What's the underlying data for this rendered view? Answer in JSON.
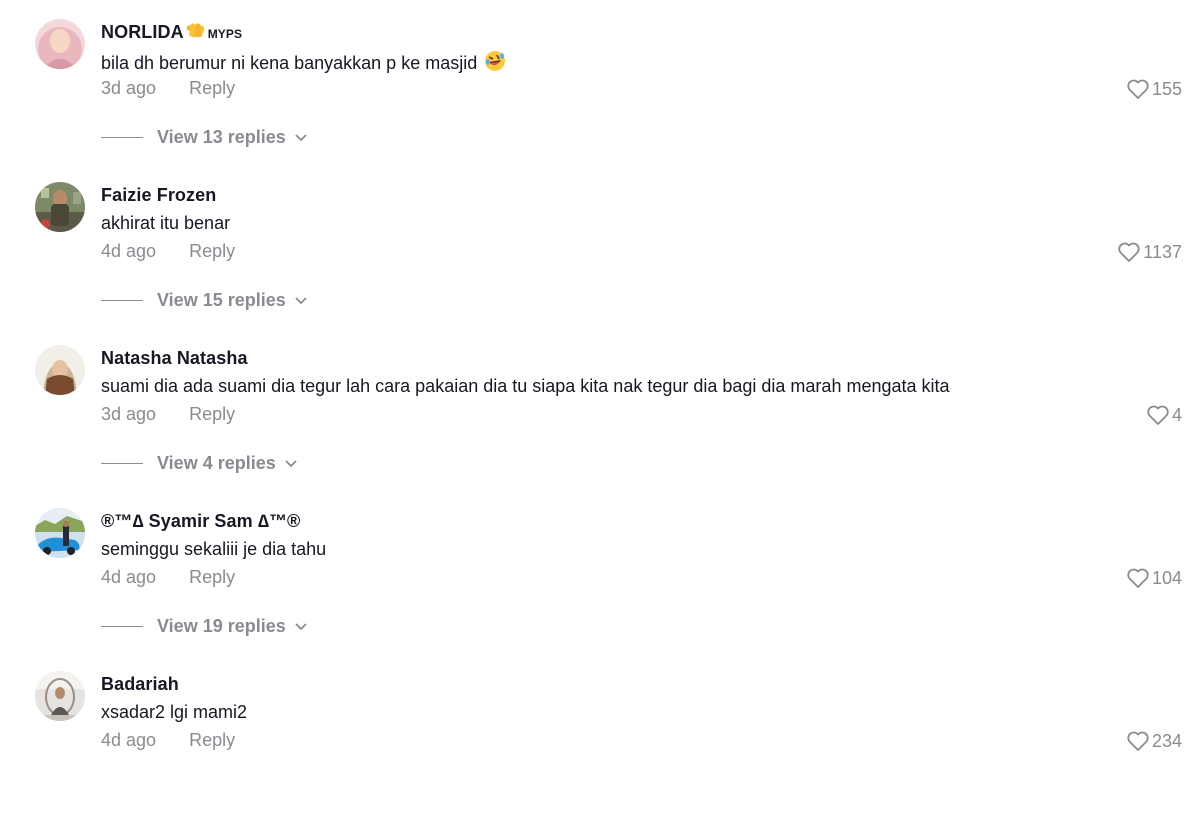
{
  "comments": [
    {
      "username": "NORLIDA",
      "badge_text": "MYPS",
      "text": "bila dh berumur ni kena banyakkan p ke masjid",
      "emoji": "rolling-on-floor-laughing-emoji",
      "time": "3d ago",
      "reply_label": "Reply",
      "likes": "155",
      "view_replies": "View 13 replies"
    },
    {
      "username": "Faizie Frozen",
      "text": "akhirat itu benar",
      "time": "4d ago",
      "reply_label": "Reply",
      "likes": "1137",
      "view_replies": "View 15 replies"
    },
    {
      "username": "Natasha Natasha",
      "text": "suami dia ada suami dia tegur lah cara pakaian dia tu siapa kita nak tegur dia bagi dia marah mengata kita",
      "time": "3d ago",
      "reply_label": "Reply",
      "likes": "4",
      "view_replies": "View 4 replies"
    },
    {
      "username": "®™∆ Syamir Sam ∆™®",
      "text": "seminggu sekaliii je dia tahu",
      "time": "4d ago",
      "reply_label": "Reply",
      "likes": "104",
      "view_replies": "View 19 replies"
    },
    {
      "username": "Badariah",
      "text": "xsadar2 lgi mami2",
      "time": "4d ago",
      "reply_label": "Reply",
      "likes": "234"
    }
  ],
  "colors": {
    "text": "#161823",
    "muted": "#8a8b91",
    "background": "#ffffff"
  },
  "icons": {
    "like": "heart-outline-icon",
    "expand": "chevron-down-icon",
    "badge": "clapping-hands-emoji"
  }
}
